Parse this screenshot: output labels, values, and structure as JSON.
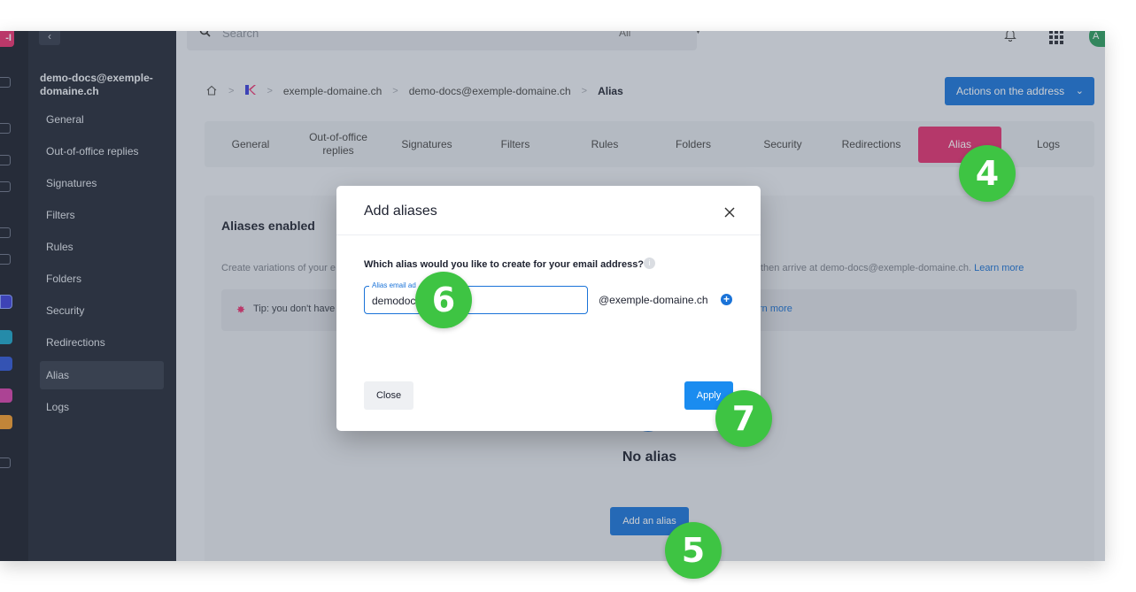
{
  "top_bar": {
    "search_placeholder": "Search",
    "scope": "All",
    "avatar_initials": "A"
  },
  "app_rail": {
    "logo_text": "-I"
  },
  "sidebar": {
    "account": "demo-docs@exemple-domaine.ch",
    "items": [
      {
        "label": "General"
      },
      {
        "label": "Out-of-office replies"
      },
      {
        "label": "Signatures"
      },
      {
        "label": "Filters"
      },
      {
        "label": "Rules"
      },
      {
        "label": "Folders"
      },
      {
        "label": "Security"
      },
      {
        "label": "Redirections"
      },
      {
        "label": "Alias"
      },
      {
        "label": "Logs"
      }
    ],
    "active": "Alias"
  },
  "breadcrumb": {
    "domain": "exemple-domaine.ch",
    "address": "demo-docs@exemple-domaine.ch",
    "current": "Alias"
  },
  "actions_button": "Actions on the address",
  "tabs": [
    {
      "label": "General"
    },
    {
      "label": "Out-of-office replies"
    },
    {
      "label": "Signatures"
    },
    {
      "label": "Filters"
    },
    {
      "label": "Rules"
    },
    {
      "label": "Folders"
    },
    {
      "label": "Security"
    },
    {
      "label": "Redirections"
    },
    {
      "label": "Alias"
    },
    {
      "label": "Logs"
    }
  ],
  "panel": {
    "title": "Aliases enabled",
    "description_start": "Create variations of your e",
    "description_end": "then arrive at demo-docs@exemple-domaine.ch.",
    "learn_more": "Learn more",
    "tip_text": "Tip: you don't have",
    "tip_link": "rn more",
    "empty_title": "No alias",
    "add_button": "Add an alias"
  },
  "modal": {
    "title": "Add aliases",
    "question": "Which alias would you like to create for your email address?",
    "field_label": "Alias email ad",
    "field_value": "demodoc",
    "domain_suffix": "@exemple-domaine.ch",
    "close_button": "Close",
    "apply_button": "Apply"
  },
  "step_badges": [
    "4",
    "5",
    "6",
    "7"
  ],
  "colors": {
    "sidebar_bg": "#232937",
    "accent_blue": "#1a73d8",
    "active_tab_pink": "#e1306f",
    "badge_green": "#3ec443"
  }
}
